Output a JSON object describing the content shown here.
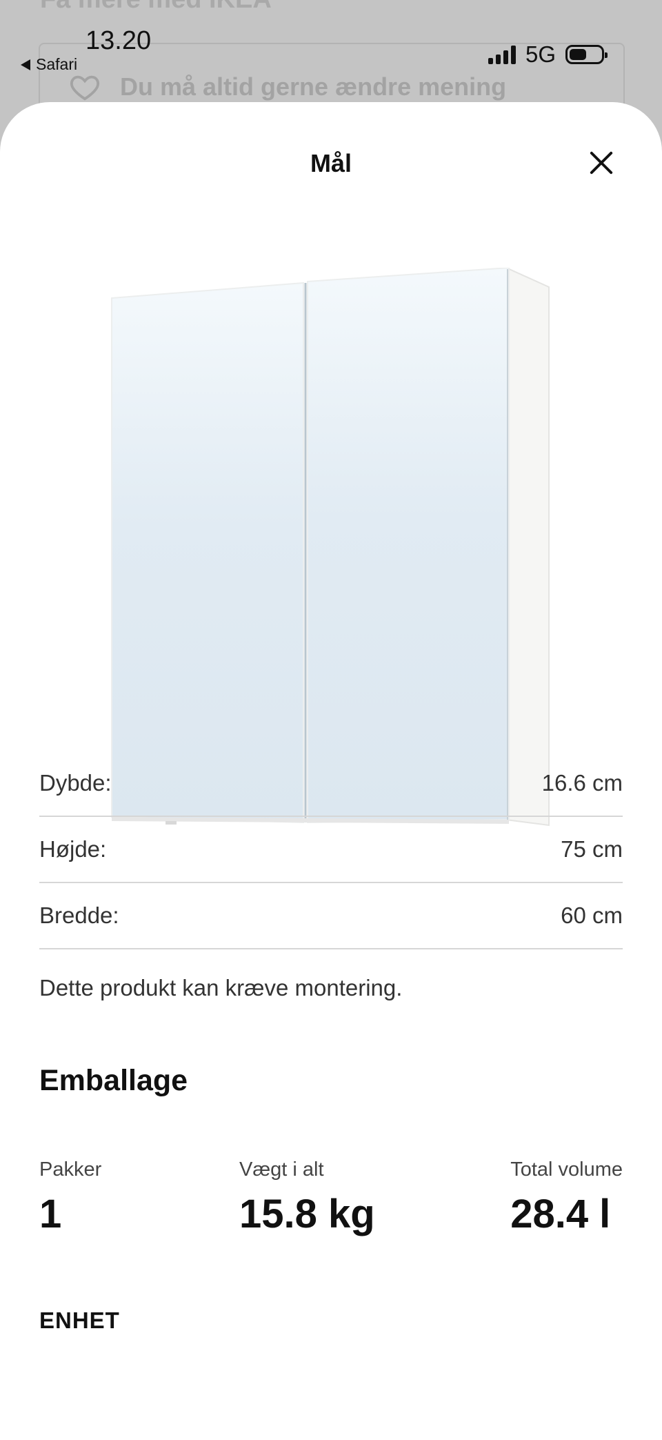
{
  "background": {
    "heading": "Få mere med IKEA",
    "banner_text": "Du må altid gerne ændre mening",
    "banner_icon": "heart-icon"
  },
  "status_bar": {
    "time": "13.20",
    "back_app": "Safari",
    "network": "5G",
    "battery_level": 0.55
  },
  "sheet": {
    "title": "Mål",
    "close_icon": "close-icon"
  },
  "dimensions": [
    {
      "label": "Dybde:",
      "value": "16.6 cm"
    },
    {
      "label": "Højde:",
      "value": "75 cm"
    },
    {
      "label": "Bredde:",
      "value": "60 cm"
    }
  ],
  "assembly_note": "Dette produkt kan kræve montering.",
  "packaging": {
    "heading": "Emballage",
    "stats": [
      {
        "label": "Pakker",
        "value": "1"
      },
      {
        "label": "Vægt i alt",
        "value": "15.8 kg"
      },
      {
        "label": "Total volume",
        "value": "28.4 l"
      }
    ]
  },
  "unit_heading": "ENHET",
  "colors": {
    "overlay": "#c4c4c4",
    "sheet": "#ffffff",
    "divider": "#d6d6d6",
    "mirror": "#dfe9f1"
  }
}
